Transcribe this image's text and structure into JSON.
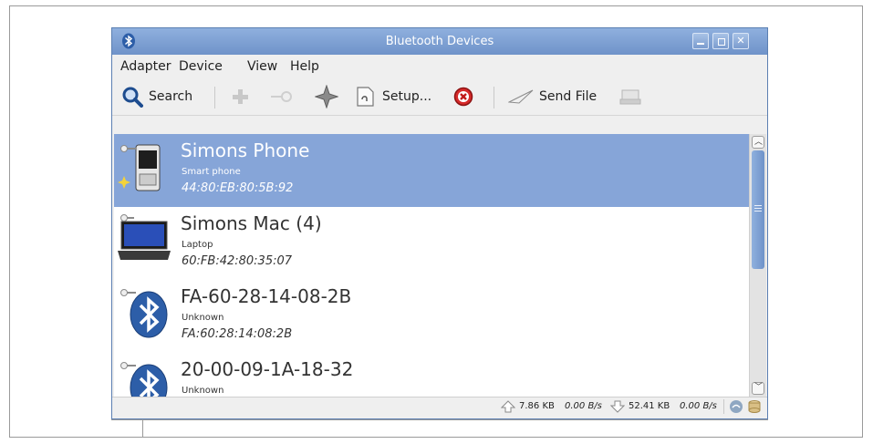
{
  "window": {
    "title": "Bluetooth Devices"
  },
  "menu": {
    "adapter": "Adapter",
    "device": "Device",
    "view": "View",
    "help": "Help"
  },
  "toolbar": {
    "search": "Search",
    "setup": "Setup...",
    "send_file": "Send File"
  },
  "devices": [
    {
      "name": "Simons Phone",
      "type": "Smart phone",
      "address": "44:80:EB:80:5B:92",
      "icon": "phone-icon",
      "selected": true
    },
    {
      "name": "Simons Mac (4)",
      "type": "Laptop",
      "address": "60:FB:42:80:35:07",
      "icon": "laptop-icon",
      "selected": false
    },
    {
      "name": "FA-60-28-14-08-2B",
      "type": "Unknown",
      "address": "FA:60:28:14:08:2B",
      "icon": "bluetooth-icon",
      "selected": false
    },
    {
      "name": "20-00-09-1A-18-32",
      "type": "Unknown",
      "address": "",
      "icon": "bluetooth-icon",
      "selected": false
    }
  ],
  "status": {
    "upload_total": "7.86 KB",
    "upload_rate": "0.00 B/s",
    "download_total": "52.41 KB",
    "download_rate": "0.00 B/s"
  },
  "colors": {
    "titlebar": "#7b9ccf",
    "selection": "#86a5d8",
    "accent": "#2d5ea8"
  }
}
